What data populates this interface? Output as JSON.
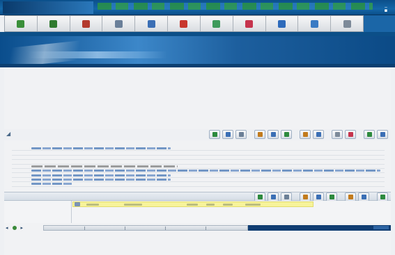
{
  "window": {
    "title": "",
    "subtitle": ""
  },
  "toolbar": {
    "tools": [
      {
        "icon": "home-icon",
        "color": "#3a8f3a"
      },
      {
        "icon": "tree-icon",
        "color": "#2f7a2f"
      },
      {
        "icon": "flag-icon",
        "color": "#b33a2e"
      },
      {
        "icon": "contact-icon",
        "color": "#6a7f99"
      },
      {
        "icon": "mail-icon",
        "color": "#3b6fb5"
      },
      {
        "icon": "calendar-icon",
        "color": "#c8372d"
      },
      {
        "icon": "globe-icon",
        "color": "#3e9a5b"
      },
      {
        "icon": "heart-icon",
        "color": "#c6344d"
      },
      {
        "icon": "document-icon",
        "color": "#2e6bbb"
      },
      {
        "icon": "chart-icon",
        "color": "#3a7bc4"
      },
      {
        "icon": "print-icon",
        "color": "#7d8a99"
      }
    ]
  },
  "record_panel": {
    "tabs": [
      "",
      "",
      ""
    ],
    "rows": [
      {
        "label": "",
        "style": "text mid"
      },
      {
        "label": "",
        "style": "empty"
      },
      {
        "label": "",
        "style": "empty"
      },
      {
        "label": "",
        "style": "empty"
      },
      {
        "label": "",
        "style": "dark"
      },
      {
        "label": "",
        "style": "text"
      },
      {
        "label": "",
        "style": "text mid"
      },
      {
        "label": "",
        "style": "text mid"
      },
      {
        "label": "",
        "style": "text short"
      }
    ]
  },
  "results_panel": {
    "label": "",
    "row": {
      "cells": [
        "",
        "",
        "",
        "",
        "",
        "",
        ""
      ]
    }
  },
  "footer": {
    "text": ""
  },
  "colors": {
    "accent": "#1466a8",
    "banner": "#0a4d8c",
    "highlight_row": "#f7f39a"
  }
}
